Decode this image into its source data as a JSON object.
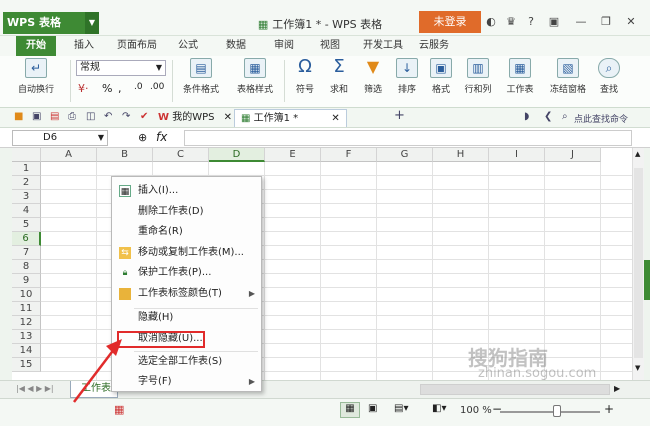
{
  "app": {
    "logo_text": "WPS 表格",
    "doc_title": "工作簿1 * - WPS 表格",
    "login_label": "未登录"
  },
  "ribbon_tabs": [
    "开始",
    "插入",
    "页面布局",
    "公式",
    "数据",
    "审阅",
    "视图",
    "开发工具",
    "云服务"
  ],
  "ribbon": {
    "wrap_label": "自动换行",
    "number_format": "常规",
    "percent_symbol": "%",
    "cond_format": "条件格式",
    "table_style": "表格样式",
    "symbol": "符号",
    "sum": "求和",
    "filter": "筛选",
    "sort": "排序",
    "format": "格式",
    "rowcol": "行和列",
    "worksheet": "工作表",
    "freeze": "冻结窗格",
    "find": "查找"
  },
  "quickbar": {
    "my_wps": "我的WPS",
    "doc_tab": "工作簿1 *",
    "add_tab": "+",
    "search_placeholder": "点此查找命令"
  },
  "formula_bar": {
    "name_box": "D6",
    "fx_label": "fx"
  },
  "grid": {
    "columns": [
      "A",
      "B",
      "C",
      "D",
      "E",
      "F",
      "G",
      "H",
      "I",
      "J"
    ],
    "rows": [
      "1",
      "2",
      "3",
      "4",
      "5",
      "6",
      "7",
      "8",
      "9",
      "10",
      "11",
      "12",
      "13",
      "14",
      "15"
    ],
    "selected_column": "D",
    "selected_row": "6"
  },
  "sheet_tabs": {
    "active": "工作表"
  },
  "statusbar": {
    "zoom": "100 %"
  },
  "context_menu": {
    "items": [
      {
        "label": "插入(I)..."
      },
      {
        "label": "删除工作表(D)"
      },
      {
        "label": "重命名(R)"
      },
      {
        "label": "移动或复制工作表(M)..."
      },
      {
        "label": "保护工作表(P)..."
      },
      {
        "label": "工作表标签颜色(T)"
      },
      {
        "label": "隐藏(H)"
      },
      {
        "label": "取消隐藏(U)..."
      },
      {
        "label": "选定全部工作表(S)"
      },
      {
        "label": "字号(F)"
      }
    ]
  },
  "watermark": {
    "brand": "搜狗指南",
    "site": "zhinan.sogou.com"
  },
  "colors": {
    "accent": "#3e8a34",
    "login_bg": "#e06b2a",
    "highlight": "#e12b2b"
  }
}
